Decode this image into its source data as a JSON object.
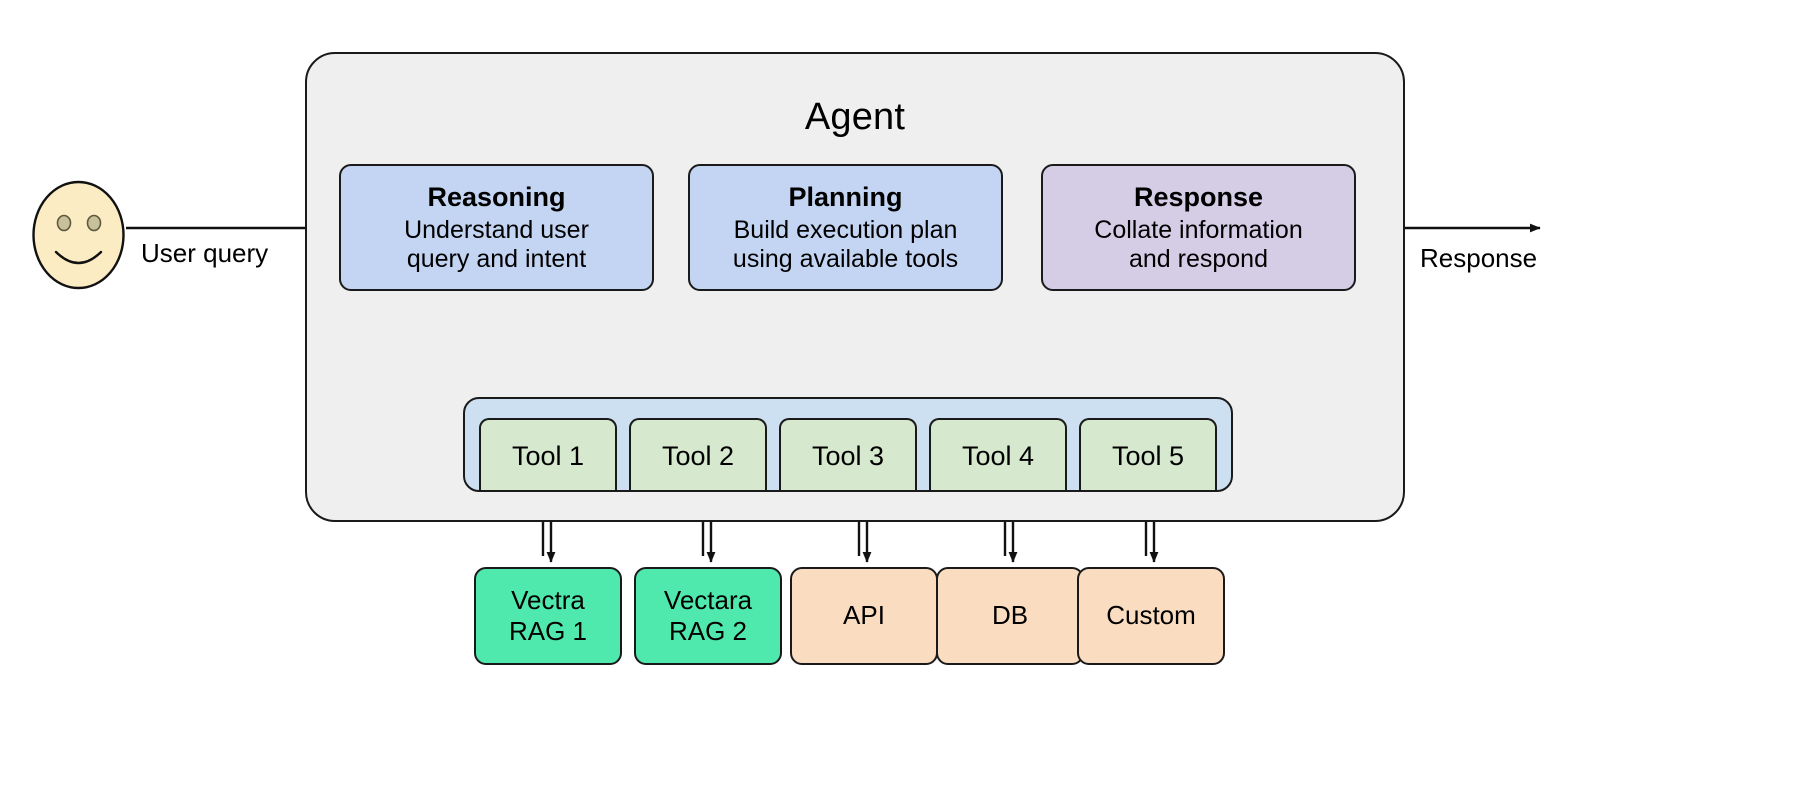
{
  "diagram": {
    "title": "Agent",
    "agent_container_color": "#efefef"
  },
  "actor": {
    "name": "user-avatar",
    "icon": "smiley-face-icon",
    "fill": "#fcecc4"
  },
  "edges": {
    "input_label": "User query",
    "output_label": "Response"
  },
  "stages": [
    {
      "id": "reasoning",
      "title": "Reasoning",
      "desc": "Understand user\nquery and intent",
      "color": "#c3d5f2"
    },
    {
      "id": "planning",
      "title": "Planning",
      "desc": "Build execution plan\nusing available tools",
      "color": "#c3d5f2"
    },
    {
      "id": "response",
      "title": "Response",
      "desc": "Collate information\nand respond",
      "color": "#d5cce6"
    }
  ],
  "tools": {
    "container_color": "#cde0f2",
    "tool_color": "#d6e8cd",
    "items": [
      {
        "label": "Tool 1"
      },
      {
        "label": "Tool 2"
      },
      {
        "label": "Tool 3"
      },
      {
        "label": "Tool 4"
      },
      {
        "label": "Tool 5"
      }
    ]
  },
  "sources": [
    {
      "label": "Vectra\nRAG 1",
      "color": "#4fe8ad"
    },
    {
      "label": "Vectara\nRAG 2",
      "color": "#4fe8ad"
    },
    {
      "label": "API",
      "color": "#fadcc0"
    },
    {
      "label": "DB",
      "color": "#fadcc0"
    },
    {
      "label": "Custom",
      "color": "#fadcc0"
    }
  ]
}
